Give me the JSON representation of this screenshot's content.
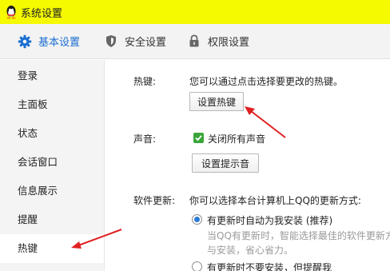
{
  "window": {
    "title": "系统设置"
  },
  "tabs": [
    {
      "label": "基本设置",
      "icon": "gear-icon",
      "active": true
    },
    {
      "label": "安全设置",
      "icon": "shield-icon"
    },
    {
      "label": "权限设置",
      "icon": "lock-icon"
    }
  ],
  "sidebar": {
    "items": [
      {
        "label": "登录"
      },
      {
        "label": "主面板"
      },
      {
        "label": "状态"
      },
      {
        "label": "会话窗口"
      },
      {
        "label": "信息展示"
      },
      {
        "label": "提醒"
      },
      {
        "label": "热键",
        "active": true
      }
    ]
  },
  "hotkey": {
    "label": "热键:",
    "description": "您可以通过点击选择要更改的热键。",
    "button": "设置热键"
  },
  "sound": {
    "label": "声音:",
    "checkbox_label": "关闭所有声音",
    "checked": true,
    "button": "设置提示音"
  },
  "update": {
    "label": "软件更新:",
    "description": "你可以选择本台计算机上QQ的更新方式:",
    "options": [
      {
        "label": "有更新时自动为我安装 (推荐)",
        "selected": true,
        "note_line1": "当QQ有更新时，智能选择最佳的软件更新方",
        "note_line2": "与安装，省心省力。"
      },
      {
        "label": "有更新时不要安装，但提醒我",
        "selected": false
      }
    ]
  },
  "colors": {
    "accent": "#1c6fd1",
    "titlebar": "#f5fa00",
    "annotation": "#e02020",
    "check": "#3aa63a"
  }
}
